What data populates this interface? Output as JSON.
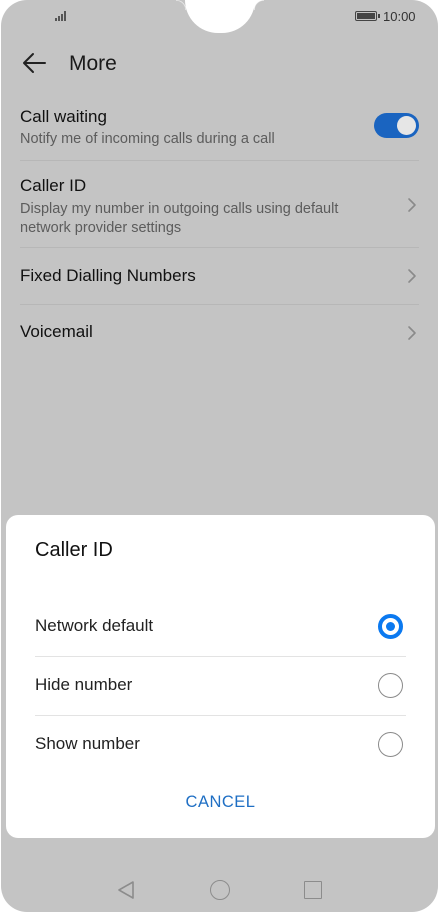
{
  "status_bar": {
    "time": "10:00"
  },
  "header": {
    "title": "More"
  },
  "settings": {
    "call_waiting": {
      "label": "Call waiting",
      "description": "Notify me of incoming calls during a call",
      "enabled": true
    },
    "caller_id": {
      "label": "Caller ID",
      "description": "Display my number in outgoing calls using default network provider settings"
    },
    "fixed_dialling": {
      "label": "Fixed Dialling Numbers"
    },
    "voicemail": {
      "label": "Voicemail"
    }
  },
  "dialog": {
    "title": "Caller ID",
    "options": [
      {
        "label": "Network default",
        "selected": true
      },
      {
        "label": "Hide number",
        "selected": false
      },
      {
        "label": "Show number",
        "selected": false
      }
    ],
    "cancel_label": "CANCEL"
  },
  "colors": {
    "accent": "#0b79f0",
    "toggle_on": "#1a64c0",
    "cancel_text": "#1f6fc4",
    "scrim_background": "#c4c4c4"
  },
  "icons": [
    "signal-icon",
    "battery-icon",
    "back-arrow-icon",
    "chevron-right-icon",
    "nav-back-icon",
    "nav-home-icon",
    "nav-recents-icon"
  ]
}
